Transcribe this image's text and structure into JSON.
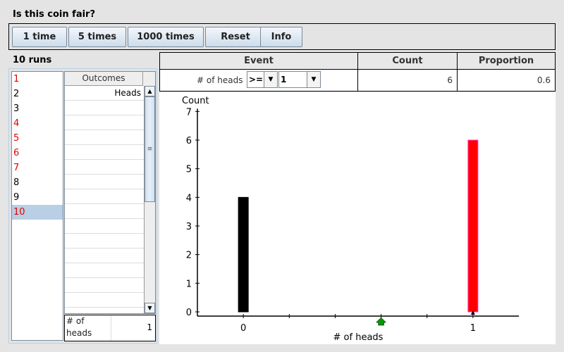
{
  "window_title": "Is this coin fair?",
  "toolbar": {
    "buttons": [
      {
        "label": "1 time"
      },
      {
        "label": "5 times"
      },
      {
        "label": "1000 times"
      },
      {
        "label": "Reset"
      },
      {
        "label": "Info"
      }
    ]
  },
  "runs": {
    "label": "10 runs",
    "items": [
      {
        "label": "1",
        "color": "#e00000"
      },
      {
        "label": "2",
        "color": "#000000"
      },
      {
        "label": "3",
        "color": "#000000"
      },
      {
        "label": "4",
        "color": "#e00000"
      },
      {
        "label": "5",
        "color": "#e00000"
      },
      {
        "label": "6",
        "color": "#e00000"
      },
      {
        "label": "7",
        "color": "#e00000"
      },
      {
        "label": "8",
        "color": "#000000"
      },
      {
        "label": "9",
        "color": "#000000"
      },
      {
        "label": "10",
        "color": "#e00000",
        "selected": true
      }
    ]
  },
  "outcomes": {
    "header": "Outcomes",
    "rows": [
      "Heads",
      "",
      "",
      "",
      "",
      "",
      "",
      "",
      "",
      "",
      "",
      "",
      "",
      "",
      "",
      ""
    ]
  },
  "summary": {
    "label": "# of heads",
    "value": "1"
  },
  "event_table": {
    "headers": {
      "event": "Event",
      "count": "Count",
      "proportion": "Proportion"
    },
    "event_label": "# of heads",
    "operator": ">=",
    "threshold": "1",
    "count": "6",
    "proportion": "0.6"
  },
  "chart_data": {
    "type": "bar",
    "title": "",
    "xlabel": "# of heads",
    "ylabel": "Count",
    "categories": [
      "0",
      "1"
    ],
    "x": [
      0,
      1
    ],
    "values": [
      4,
      6
    ],
    "bar_colors": [
      "#000000",
      "#ff0000"
    ],
    "bar_outline_colors": [
      "#000000",
      "#ff33cc"
    ],
    "ylim": [
      0,
      7
    ],
    "xlim": [
      -0.2,
      1.2
    ],
    "yticks": [
      0,
      1,
      2,
      3,
      4,
      5,
      6,
      7
    ],
    "xticks": [
      0,
      0.2,
      0.4,
      0.6,
      0.8,
      1
    ],
    "xtick_labels": [
      "0",
      "1"
    ],
    "mean_marker": {
      "x": 0.6,
      "color": "#009900"
    },
    "observed_marker": {
      "x": 1,
      "color": "#000000"
    },
    "grid": false
  }
}
